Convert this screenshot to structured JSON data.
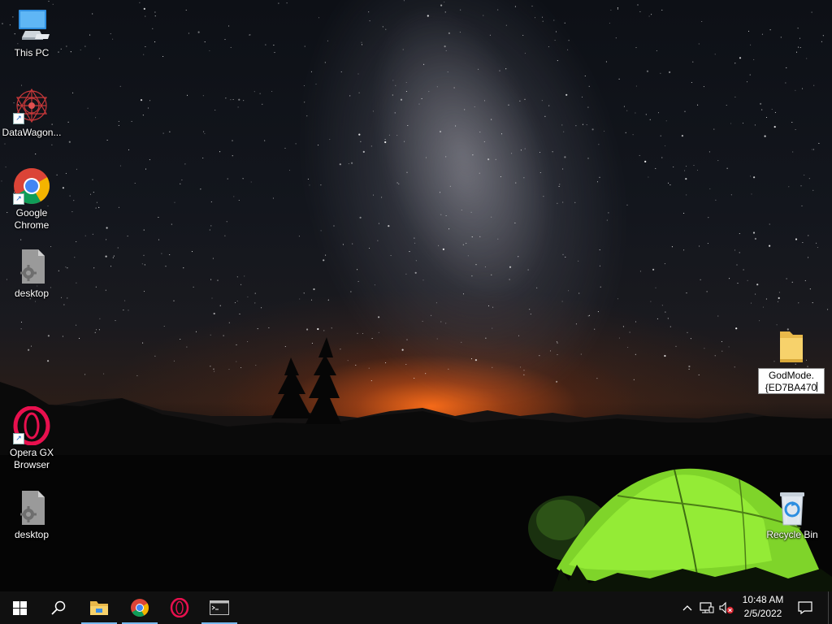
{
  "desktop": {
    "icons": [
      {
        "label": "This PC",
        "icon": "this-pc-icon"
      },
      {
        "label": "DataWagon...",
        "icon": "datawagon-icon"
      },
      {
        "label": "Google Chrome",
        "icon": "chrome-icon"
      },
      {
        "label": "desktop",
        "icon": "settings-file-icon"
      },
      {
        "label": "Opera GX Browser",
        "icon": "opera-gx-icon"
      },
      {
        "label": "desktop",
        "icon": "settings-file-icon"
      },
      {
        "label": "Recycle Bin",
        "icon": "recycle-bin-icon"
      }
    ],
    "renaming_folder": {
      "line1": "GodMode.",
      "line2": "{ED7BA470",
      "icon": "folder-icon"
    }
  },
  "taskbar": {
    "start": "start-icon",
    "search": "search-icon",
    "pinned": [
      {
        "name": "File Explorer",
        "icon": "file-explorer-icon",
        "active": true
      },
      {
        "name": "Google Chrome",
        "icon": "chrome-icon",
        "active": true
      },
      {
        "name": "Opera GX",
        "icon": "opera-gx-icon",
        "active": false
      },
      {
        "name": "Command Prompt",
        "icon": "cmd-icon",
        "active": true
      }
    ],
    "tray": {
      "chevron": "chevron-up-icon",
      "network": "network-icon",
      "volume": "volume-muted-icon",
      "time": "10:48 AM",
      "date": "2/5/2022",
      "notifications": "notification-icon"
    }
  },
  "colors": {
    "taskbar_bg": "#101010",
    "active_indicator": "#76b9ed",
    "tent_green": "#8ee62a",
    "horizon_orange": "#ff6e19"
  }
}
